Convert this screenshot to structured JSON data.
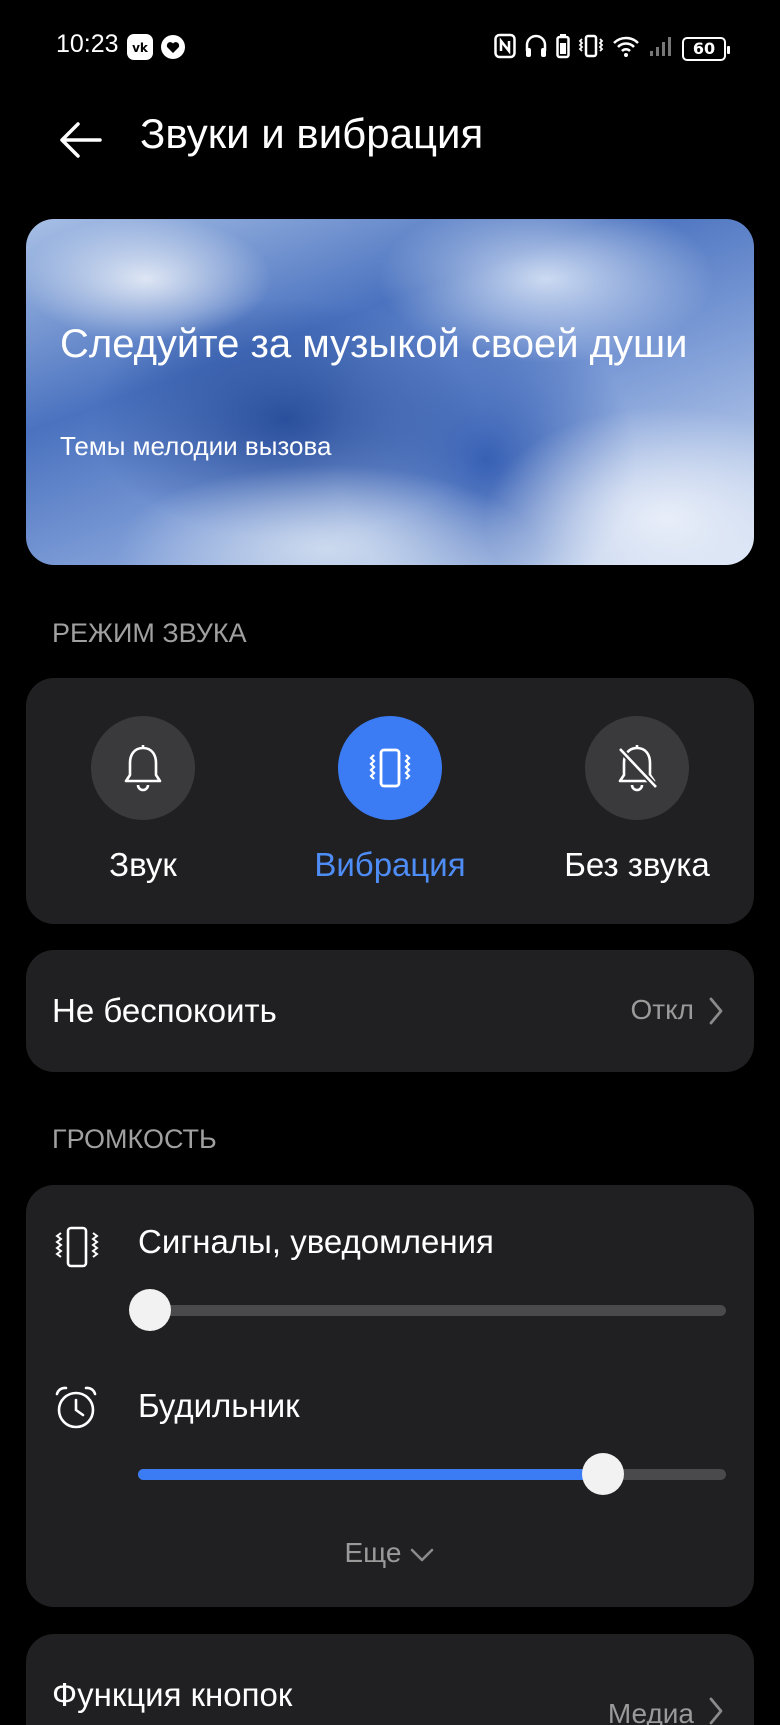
{
  "status_bar": {
    "time": "10:23",
    "battery": "60",
    "left_icons": [
      "vk-icon",
      "heart-icon"
    ],
    "right_icons": [
      "nfc-icon",
      "headphones-icon",
      "battery-small-icon",
      "vibrate-icon",
      "wifi-icon",
      "signal-icon",
      "battery-icon"
    ]
  },
  "header": {
    "title": "Звуки и вибрация"
  },
  "banner": {
    "title": "Следуйте за музыкой своей души",
    "subtitle": "Темы мелодии вызова"
  },
  "sound_mode": {
    "section_label": "РЕЖИМ ЗВУКА",
    "modes": [
      {
        "label": "Звук",
        "icon": "bell-icon",
        "active": false
      },
      {
        "label": "Вибрация",
        "icon": "vibrate-icon",
        "active": true
      },
      {
        "label": "Без звука",
        "icon": "bell-off-icon",
        "active": false
      }
    ]
  },
  "do_not_disturb": {
    "label": "Не беспокоить",
    "value": "Откл"
  },
  "volume": {
    "section_label": "ГРОМКОСТЬ",
    "sliders": [
      {
        "label": "Сигналы, уведомления",
        "icon": "vibrate-icon",
        "level": 0.02
      },
      {
        "label": "Будильник",
        "icon": "alarm-clock-icon",
        "level": 0.79
      }
    ],
    "more_label": "Еще"
  },
  "button_function": {
    "label": "Функция кнопок",
    "value": "Медиа"
  },
  "colors": {
    "accent": "#3b7cf5",
    "card": "#202022",
    "background": "#000000"
  }
}
